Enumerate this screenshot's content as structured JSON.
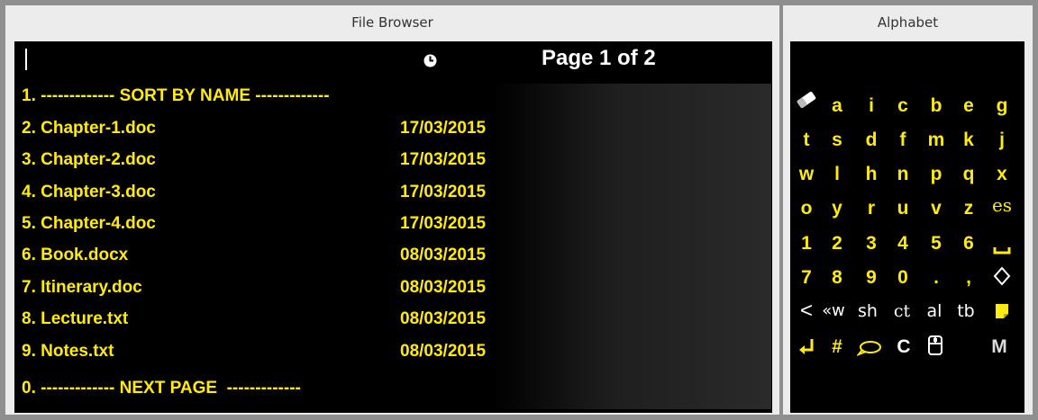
{
  "file_browser": {
    "title": "File Browser",
    "page_indicator": "Page 1 of 2",
    "items": [
      {
        "label": "1. ------------- SORT BY NAME -------------",
        "date": ""
      },
      {
        "label": "2. Chapter-1.doc",
        "date": "17/03/2015"
      },
      {
        "label": "3. Chapter-2.doc",
        "date": "17/03/2015"
      },
      {
        "label": "4. Chapter-3.doc",
        "date": "17/03/2015"
      },
      {
        "label": "5. Chapter-4.doc",
        "date": "17/03/2015"
      },
      {
        "label": "6. Book.docx",
        "date": "08/03/2015"
      },
      {
        "label": "7. Itinerary.doc",
        "date": "08/03/2015"
      },
      {
        "label": "8. Lecture.txt",
        "date": "08/03/2015"
      },
      {
        "label": "9. Notes.txt",
        "date": "08/03/2015"
      },
      {
        "label": "0. ------------- NEXT PAGE  -------------",
        "date": ""
      }
    ]
  },
  "alphabet": {
    "title": "Alphabet",
    "row1": [
      "a",
      "i",
      "c",
      "b",
      "e",
      "g"
    ],
    "row2": [
      "t",
      "s",
      "d",
      "f",
      "m",
      "k",
      "j"
    ],
    "row3": [
      "w",
      "l",
      "h",
      "n",
      "p",
      "q",
      "x"
    ],
    "row4": [
      "o",
      "y",
      "r",
      "u",
      "v",
      "z",
      "es"
    ],
    "row5": [
      "1",
      "2",
      "3",
      "4",
      "5",
      "6"
    ],
    "row6": [
      "7",
      "8",
      "9",
      "0",
      ".",
      ","
    ],
    "row7": [
      "<",
      "«w",
      "sh",
      "ct",
      "al",
      "tb"
    ],
    "row8": [
      "#",
      "C",
      "M"
    ],
    "icons": {
      "eraser": "eraser-icon",
      "space": "space-icon",
      "diamond": "diamond-icon",
      "note": "note-icon",
      "enter": "enter-icon",
      "speech": "speech-bubble-icon",
      "mouse": "mouse-icon"
    }
  },
  "colors": {
    "text_yellow": "#ffeb0f",
    "background": "#000000",
    "frame": "#ececec"
  }
}
